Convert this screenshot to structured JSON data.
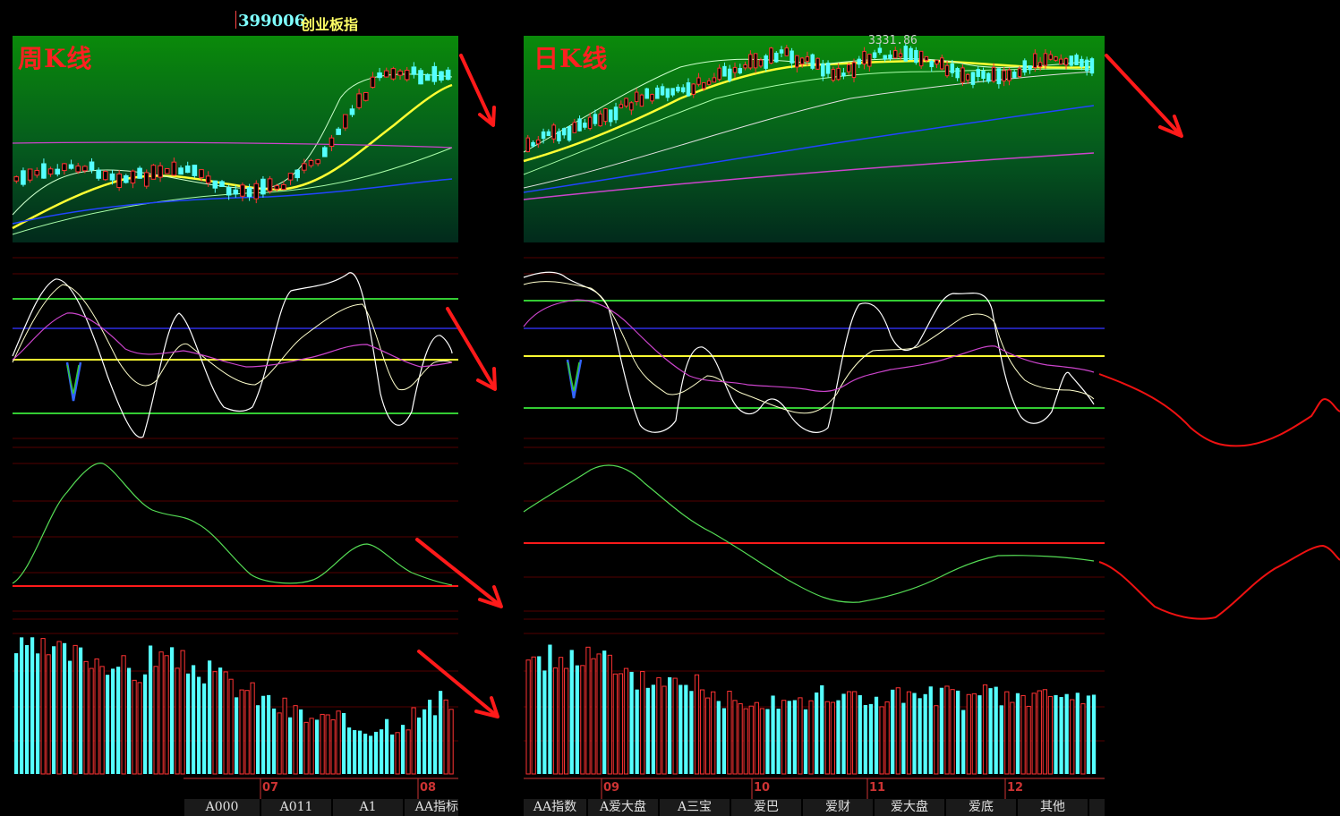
{
  "header": {
    "code": "399006",
    "name": "创业板指"
  },
  "left_panel": {
    "title": "周K线",
    "months": [
      "07",
      "08"
    ],
    "tabs": [
      "A000",
      "A011",
      "A1",
      "AA指标"
    ]
  },
  "right_panel": {
    "title": "日K线",
    "high_price": "3331.86",
    "months": [
      "09",
      "10",
      "11",
      "12"
    ],
    "tabs": [
      "AA指数",
      "A爱大盘",
      "A三宝",
      "爱巴",
      "爱财",
      "爱大盘",
      "爱底",
      "其他"
    ]
  },
  "colors": {
    "background": "#000000",
    "kline_bg_top": "#008800",
    "up_candle": "#ff3333",
    "down_candle": "#55ffff",
    "signal_line": "#ff1a1a",
    "ma_yellow": "#ffff33",
    "ma_blue": "#2244ff",
    "ma_purple": "#cc44cc"
  }
}
